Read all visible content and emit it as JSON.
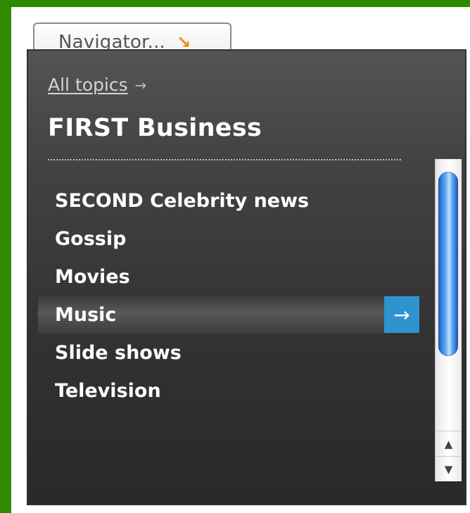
{
  "navigator": {
    "label": "Navigator...",
    "arrow_icon": "↘"
  },
  "panel": {
    "back_link": "All topics",
    "back_arrow": "→",
    "title": "FIRST Business",
    "items": [
      {
        "label": "SECOND Celebrity news"
      },
      {
        "label": "Gossip"
      },
      {
        "label": "Movies"
      },
      {
        "label": "Music",
        "selected": true
      },
      {
        "label": "Slide shows"
      },
      {
        "label": "Television"
      }
    ],
    "selected_action_icon": "→"
  },
  "scrollbar": {
    "up_icon": "▲",
    "down_icon": "▼"
  },
  "colors": {
    "frame_green": "#2e8a00",
    "accent_orange": "#f08a00",
    "selected_button_blue": "#2f93cf",
    "panel_dark": "#3a3a3b"
  }
}
